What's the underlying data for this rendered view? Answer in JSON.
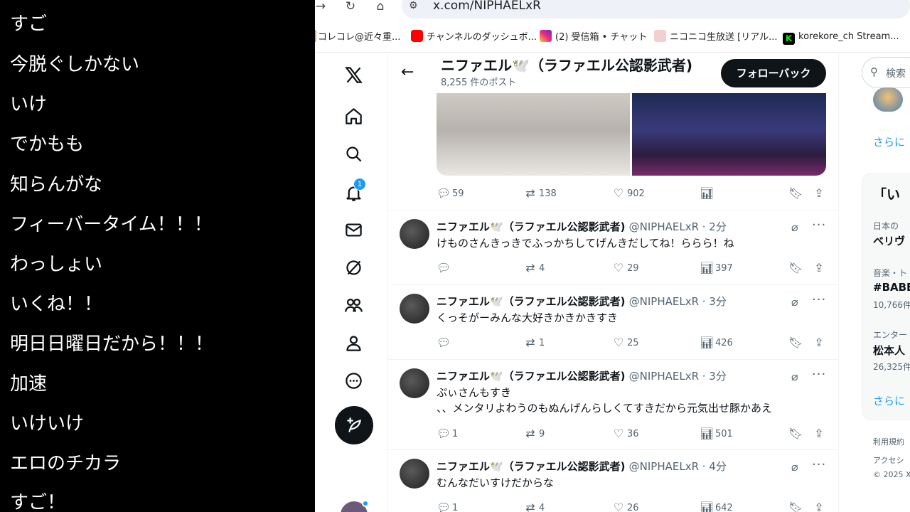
{
  "chat": {
    "lines": [
      "すご",
      "今脱ぐしかない",
      "いけ",
      "でかもも",
      "知らんがな",
      "フィーバータイム！！！",
      "わっしょい",
      "いくね！！",
      "明日日曜日だから！！！",
      "加速",
      "いけいけ",
      "エロのチカラ",
      "すご！"
    ]
  },
  "browser": {
    "url": "x.com/NIPHAELxR",
    "bookmarks": [
      {
        "label": "コレコレ@近々重...",
        "color": "#f2a25a"
      },
      {
        "label": "チャンネルのダッシュボ...",
        "color": "#ff0000"
      },
      {
        "label": "(2) 受信箱 • チャット",
        "color": "#d62976"
      },
      {
        "label": "ニコニコ生放送 [リアル...",
        "color": "#e9a0a0"
      },
      {
        "label": "korekore_ch Stream...",
        "color": "#00c805"
      }
    ]
  },
  "profile": {
    "name": "ニファエル🕊️（ラファエル公認影武者)",
    "post_count": "8,255 件のポスト",
    "follow_back": "フォローバック"
  },
  "nav": {
    "notification_count": "1"
  },
  "media_post": {
    "replies": "59",
    "reposts": "138",
    "likes": "902"
  },
  "tweets": [
    {
      "name": "ニファエル🕊️（ラファエル公認影武者)",
      "handle": "@NIPHAELxR · 2分",
      "text": "けものさんきっきでふっかちしてげんきだしてね！ららら！ね",
      "replies": "",
      "reposts": "4",
      "likes": "29",
      "views": "397"
    },
    {
      "name": "ニファエル🕊️（ラファエル公認影武者)",
      "handle": "@NIPHAELxR · 3分",
      "text": "くっそがーみんな大好きかきかきすき",
      "replies": "",
      "reposts": "1",
      "likes": "25",
      "views": "426"
    },
    {
      "name": "ニファエル🕊️（ラファエル公認影武者)",
      "handle": "@NIPHAELxR · 3分",
      "text": "ぷぃさんもすき\n、、メンタリよわうのもぬんげんらしくてすきだから元気出せ豚かあえ",
      "replies": "1",
      "reposts": "9",
      "likes": "36",
      "views": "501"
    },
    {
      "name": "ニファエル🕊️（ラファエル公認影武者)",
      "handle": "@NIPHAELxR · 4分",
      "text": "むんなだいすけだからな",
      "replies": "1",
      "reposts": "4",
      "likes": "26",
      "views": "642"
    }
  ],
  "right": {
    "search_placeholder": "検索",
    "more_link_1": "さらに",
    "trend_title": "「い",
    "trends": [
      {
        "category": "日本の",
        "name": "ベリヴ",
        "count": ""
      },
      {
        "category": "音楽・ト",
        "name": "#BABE",
        "count": "10,766件"
      },
      {
        "category": "エンター",
        "name": "松本人",
        "count": "26,325件"
      }
    ],
    "more_link_2": "さらに",
    "footer_1": "利用規約",
    "footer_2": "アクセシ",
    "footer_3": "© 2025 X"
  }
}
